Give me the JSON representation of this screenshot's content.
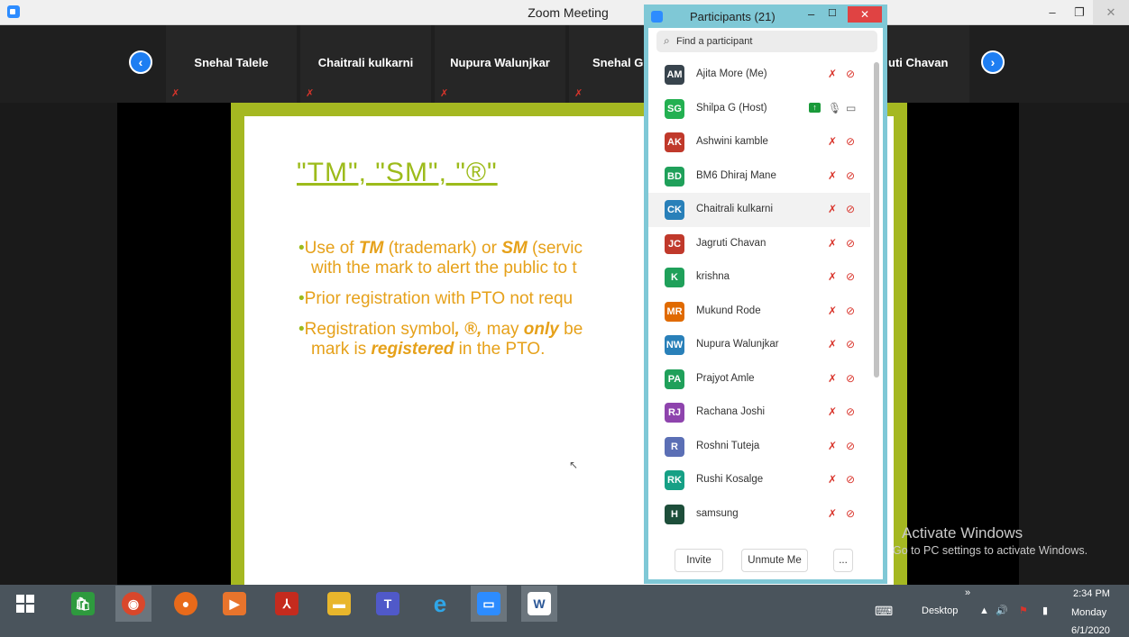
{
  "window": {
    "title": "Zoom Meeting"
  },
  "gallery": {
    "tiles": [
      {
        "name": "Snehal Talele"
      },
      {
        "name": "Chaitrali kulkarni"
      },
      {
        "name": "Nupura Walunjkar"
      },
      {
        "name": "Snehal G"
      },
      {
        "name": "uti Chavan"
      }
    ]
  },
  "slide": {
    "title": "\"TM\", \"SM\", \"®\"",
    "b1_a": "Use of ",
    "b1_b": "TM",
    "b1_c": " (trademark) or ",
    "b1_d": "SM",
    "b1_e": " (servic",
    "b1_line2": "with the mark to alert the public to t",
    "b2": "Prior registration with PTO not requ",
    "b3_a": "Registration symbol",
    "b3_b": ", ®,",
    "b3_c": " may ",
    "b3_d": "only",
    "b3_e": " be",
    "b3_line2_a": "mark is ",
    "b3_line2_b": "registered",
    "b3_line2_c": " in the PTO."
  },
  "participants_panel": {
    "title": "Participants (21)",
    "search_placeholder": "Find a participant",
    "items": [
      {
        "initials": "AM",
        "name": "Ajita More (Me)",
        "color": "#38444d"
      },
      {
        "initials": "SG",
        "name": "Shilpa G (Host)",
        "color": "#23b051"
      },
      {
        "initials": "AK",
        "name": "Ashwini kamble",
        "color": "#c0392b"
      },
      {
        "initials": "BD",
        "name": "BM6 Dhiraj Mane",
        "color": "#1fa05a"
      },
      {
        "initials": "CK",
        "name": "Chaitrali kulkarni",
        "color": "#2980b9"
      },
      {
        "initials": "JC",
        "name": "Jagruti Chavan",
        "color": "#c0392b"
      },
      {
        "initials": "K",
        "name": "krishna",
        "color": "#1fa05a"
      },
      {
        "initials": "MR",
        "name": "Mukund Rode",
        "color": "#e06a00"
      },
      {
        "initials": "NW",
        "name": "Nupura Walunjkar",
        "color": "#2980b9"
      },
      {
        "initials": "PA",
        "name": "Prajyot Amle",
        "color": "#1fa05a"
      },
      {
        "initials": "RJ",
        "name": "Rachana Joshi",
        "color": "#8e44ad"
      },
      {
        "initials": "R",
        "name": "Roshni Tuteja",
        "color": "#5b6fb5"
      },
      {
        "initials": "RK",
        "name": "Rushi Kosalge",
        "color": "#16a085"
      },
      {
        "initials": "H",
        "name": "samsung",
        "color": "#1d4e3a"
      }
    ],
    "invite_label": "Invite",
    "unmute_label": "Unmute Me",
    "more_label": "..."
  },
  "activate": {
    "line1": "Activate Windows",
    "line2": "Go to PC settings to activate Windows."
  },
  "taskbar": {
    "desktop_label": "Desktop",
    "chevron": "»",
    "time": "2:34 PM",
    "day": "Monday",
    "date": "6/1/2020"
  }
}
